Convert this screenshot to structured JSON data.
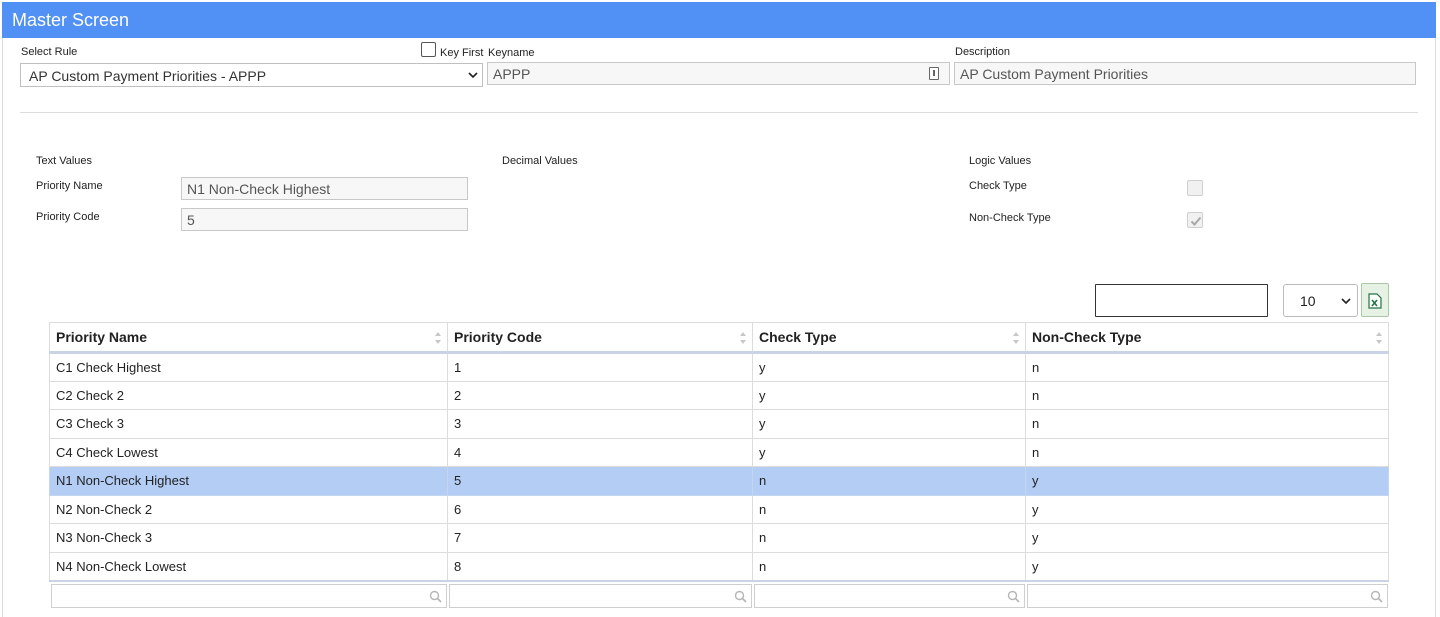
{
  "window": {
    "title": "Master Screen"
  },
  "header": {
    "select_rule_label": "Select Rule",
    "select_rule_value": "AP Custom Payment Priorities - APPP",
    "key_first_label": "Key First",
    "keyname_label": "Keyname",
    "keyname_value": "APPP",
    "description_label": "Description",
    "description_value": "AP Custom Payment Priorities"
  },
  "sections": {
    "text_values": "Text Values",
    "decimal_values": "Decimal Values",
    "logic_values": "Logic Values"
  },
  "text_fields": {
    "priority_name_label": "Priority Name",
    "priority_name_value": "N1 Non-Check Highest",
    "priority_code_label": "Priority Code",
    "priority_code_value": "5"
  },
  "logic_fields": {
    "check_type_label": "Check Type",
    "check_type_checked": false,
    "non_check_type_label": "Non-Check Type",
    "non_check_type_checked": true
  },
  "grid_controls": {
    "page_size": "10"
  },
  "table": {
    "columns": [
      "Priority Name",
      "Priority Code",
      "Check Type",
      "Non-Check Type"
    ],
    "rows": [
      [
        "C1 Check Highest",
        "1",
        "y",
        "n"
      ],
      [
        "C2 Check 2",
        "2",
        "y",
        "n"
      ],
      [
        "C3 Check 3",
        "3",
        "y",
        "n"
      ],
      [
        "C4 Check Lowest",
        "4",
        "y",
        "n"
      ],
      [
        "N1 Non-Check Highest",
        "5",
        "n",
        "y"
      ],
      [
        "N2 Non-Check 2",
        "6",
        "n",
        "y"
      ],
      [
        "N3 Non-Check 3",
        "7",
        "n",
        "y"
      ],
      [
        "N4 Non-Check Lowest",
        "8",
        "n",
        "y"
      ]
    ],
    "selected_row": 4
  },
  "colors": {
    "titlebar": "#5190f5",
    "selected_row": "#b3cdf5",
    "excel_green": "#217346"
  },
  "icons": {
    "excel": "excel-export-icon",
    "search": "magnifier-icon",
    "sort": "sort-arrows-icon",
    "keyname": "key-badge-icon"
  }
}
